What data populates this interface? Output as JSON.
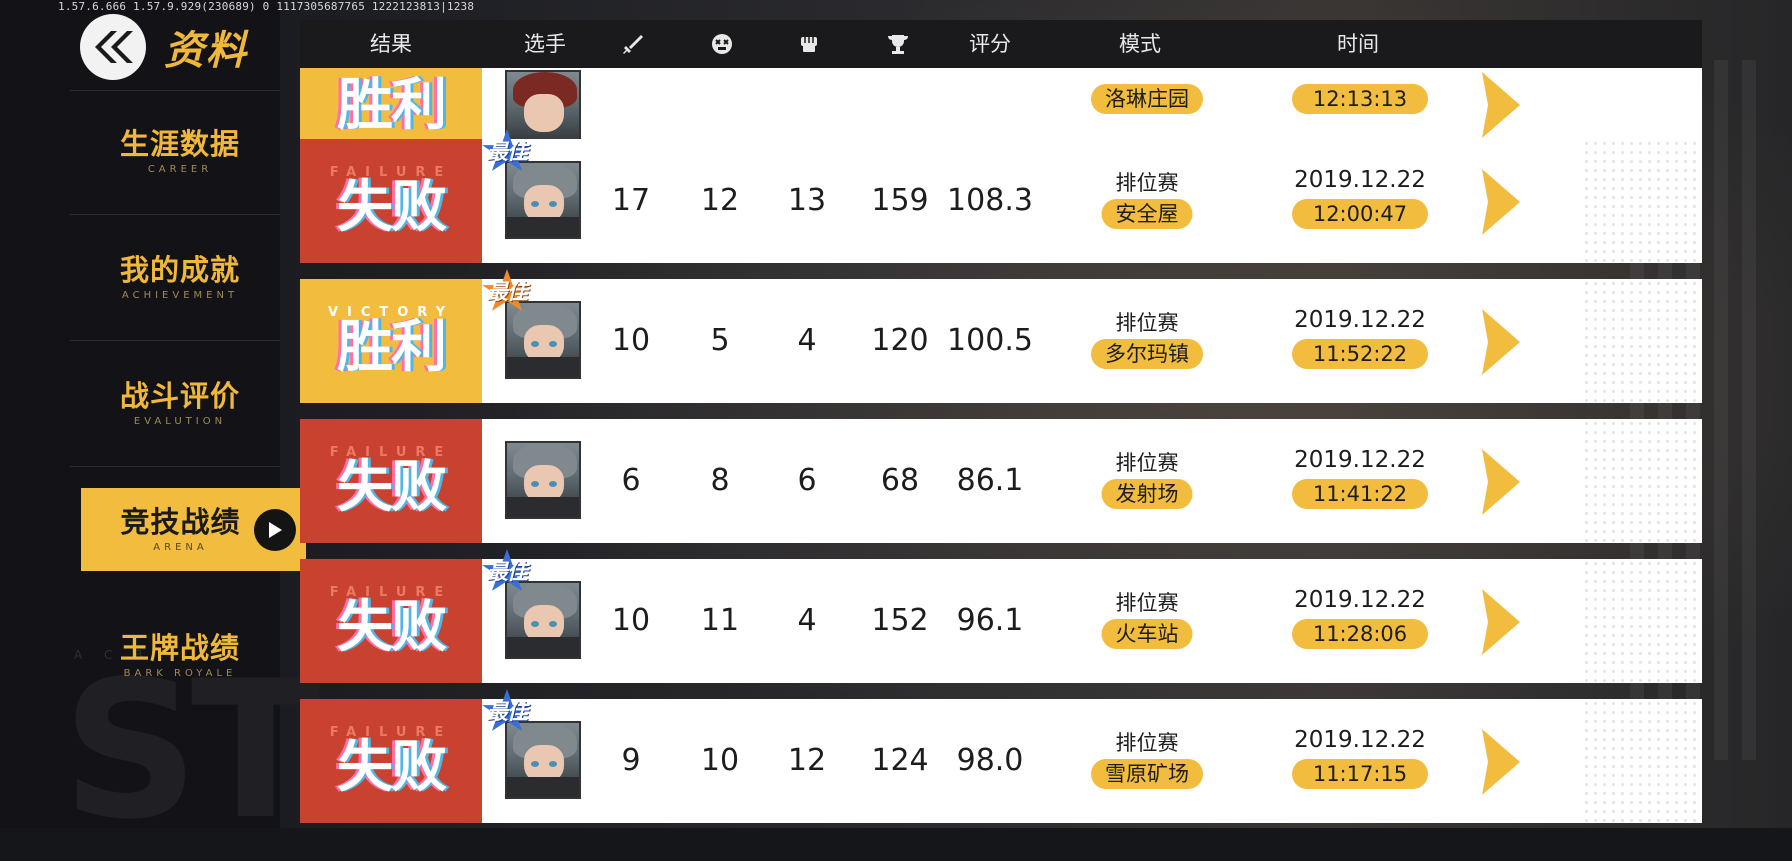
{
  "debug_info": "1.57.6.666  1.57.9.929(230689)  0  1117305687765    1222123813|1238",
  "sidebar": {
    "title": "资料",
    "watermark": "ST",
    "watermark_sub": "A C         B",
    "items": [
      {
        "zh": "生涯数据",
        "en": "CAREER",
        "active": false
      },
      {
        "zh": "我的成就",
        "en": "ACHIEVEMENT",
        "active": false
      },
      {
        "zh": "战斗评价",
        "en": "EVALUTION",
        "active": false
      },
      {
        "zh": "竞技战绩",
        "en": "ARENA",
        "active": true
      },
      {
        "zh": "王牌战绩",
        "en": "BARK ROYALE",
        "active": false
      }
    ]
  },
  "header": {
    "result": "结果",
    "player": "选手",
    "kills_icon": "sword-icon",
    "deaths_icon": "skull-icon",
    "assists_icon": "fist-icon",
    "trophy_icon": "trophy-icon",
    "score": "评分",
    "mode": "模式",
    "time": "时间"
  },
  "colors": {
    "accent": "#f2bd3f",
    "failure": "#c9412f",
    "best_blue": "#3a6fd8",
    "best_orange": "#f08a2c"
  },
  "top_partial": {
    "result_zh": "胜利",
    "map": "洛琳庄园",
    "time": "12:13:13"
  },
  "matches": [
    {
      "result": "failure",
      "result_en": "FAILURE",
      "result_zh": "失败",
      "best": true,
      "best_color": "blue",
      "best_label": "最佳",
      "kills": "17",
      "deaths": "12",
      "assists": "13",
      "trophies": "159",
      "score": "108.3",
      "mode": "排位赛",
      "map": "安全屋",
      "date": "2019.12.22",
      "time": "12:00:47"
    },
    {
      "result": "victory",
      "result_en": "VICTORY",
      "result_zh": "胜利",
      "best": true,
      "best_color": "orange",
      "best_label": "最佳",
      "kills": "10",
      "deaths": "5",
      "assists": "4",
      "trophies": "120",
      "score": "100.5",
      "mode": "排位赛",
      "map": "多尔玛镇",
      "date": "2019.12.22",
      "time": "11:52:22"
    },
    {
      "result": "failure",
      "result_en": "FAILURE",
      "result_zh": "失败",
      "best": false,
      "best_color": "",
      "best_label": "",
      "kills": "6",
      "deaths": "8",
      "assists": "6",
      "trophies": "68",
      "score": "86.1",
      "mode": "排位赛",
      "map": "发射场",
      "date": "2019.12.22",
      "time": "11:41:22"
    },
    {
      "result": "failure",
      "result_en": "FAILURE",
      "result_zh": "失败",
      "best": true,
      "best_color": "blue",
      "best_label": "最佳",
      "kills": "10",
      "deaths": "11",
      "assists": "4",
      "trophies": "152",
      "score": "96.1",
      "mode": "排位赛",
      "map": "火车站",
      "date": "2019.12.22",
      "time": "11:28:06"
    },
    {
      "result": "failure",
      "result_en": "FAILURE",
      "result_zh": "失败",
      "best": true,
      "best_color": "blue",
      "best_label": "最佳",
      "kills": "9",
      "deaths": "10",
      "assists": "12",
      "trophies": "124",
      "score": "98.0",
      "mode": "排位赛",
      "map": "雪原矿场",
      "date": "2019.12.22",
      "time": "11:17:15"
    }
  ]
}
